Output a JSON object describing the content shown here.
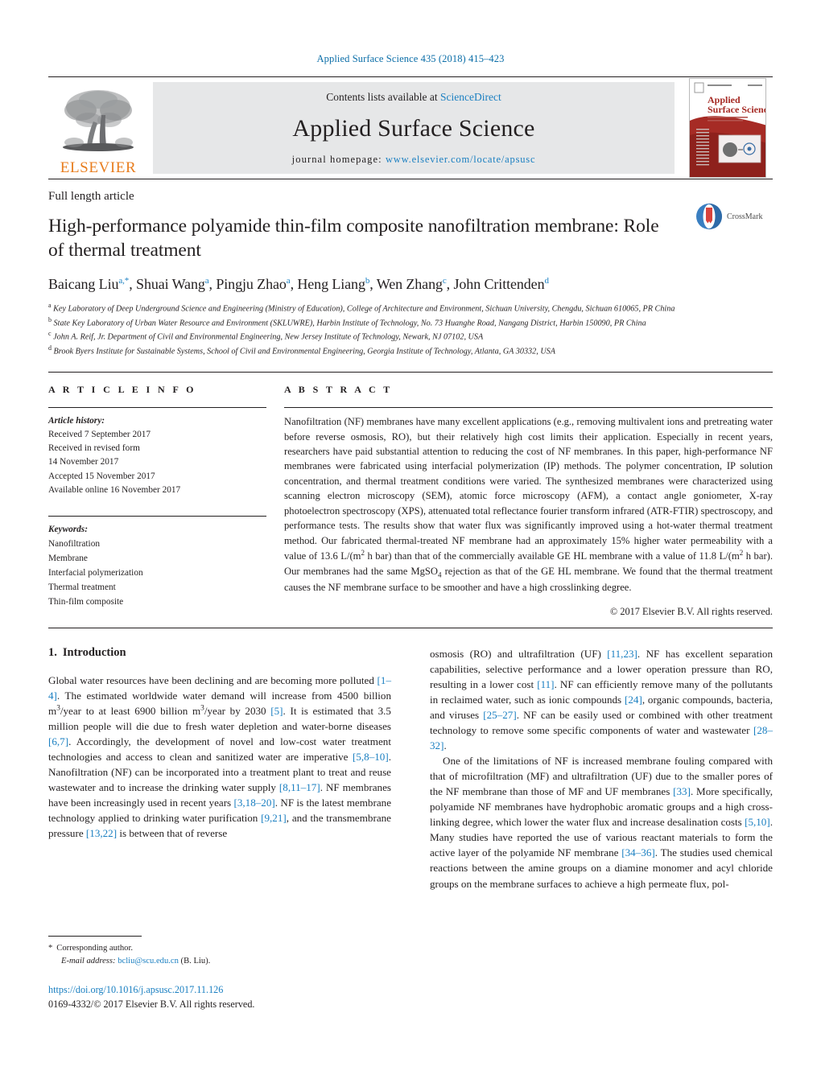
{
  "running_head": "Applied Surface Science 435 (2018) 415–423",
  "masthead": {
    "publisher_wordmark": "ELSEVIER",
    "contents_prefix": "Contents lists available at ",
    "contents_link": "ScienceDirect",
    "journal_name": "Applied Surface Science",
    "homepage_prefix": "journal homepage: ",
    "homepage_url": "www.elsevier.com/locate/apsusc",
    "cover": {
      "title_line1": "Applied",
      "title_line2": "Surface Science"
    }
  },
  "article": {
    "kicker": "Full length article",
    "title": "High-performance polyamide thin-film composite nanofiltration membrane: Role of thermal treatment",
    "crossmark_label": "CrossMark",
    "authors": [
      {
        "name": "Baicang Liu",
        "marks": "a,*"
      },
      {
        "name": "Shuai Wang",
        "marks": "a"
      },
      {
        "name": "Pingju Zhao",
        "marks": "a"
      },
      {
        "name": "Heng Liang",
        "marks": "b"
      },
      {
        "name": "Wen Zhang",
        "marks": "c"
      },
      {
        "name": "John Crittenden",
        "marks": "d"
      }
    ],
    "affiliations": [
      {
        "mark": "a",
        "text": "Key Laboratory of Deep Underground Science and Engineering (Ministry of Education), College of Architecture and Environment, Sichuan University, Chengdu, Sichuan 610065, PR China"
      },
      {
        "mark": "b",
        "text": "State Key Laboratory of Urban Water Resource and Environment (SKLUWRE), Harbin Institute of Technology, No. 73 Huanghe Road, Nangang District, Harbin 150090, PR China"
      },
      {
        "mark": "c",
        "text": "John A. Reif, Jr. Department of Civil and Environmental Engineering, New Jersey Institute of Technology, Newark, NJ 07102, USA"
      },
      {
        "mark": "d",
        "text": "Brook Byers Institute for Sustainable Systems, School of Civil and Environmental Engineering, Georgia Institute of Technology, Atlanta, GA 30332, USA"
      }
    ]
  },
  "article_info": {
    "heading": "A R T I C L E   I N F O",
    "history_label": "Article history:",
    "history": [
      "Received 7 September 2017",
      "Received in revised form",
      "14 November 2017",
      "Accepted 15 November 2017",
      "Available online 16 November 2017"
    ],
    "keywords_label": "Keywords:",
    "keywords": [
      "Nanofiltration",
      "Membrane",
      "Interfacial polymerization",
      "Thermal treatment",
      "Thin-film composite"
    ]
  },
  "abstract": {
    "heading": "A B S T R A C T",
    "copyright": "© 2017 Elsevier B.V. All rights reserved.",
    "parts": [
      {
        "t": "Nanofiltration (NF) membranes have many excellent applications (e.g., removing multivalent ions and pretreating water before reverse osmosis, RO), but their relatively high cost limits their application. Especially in recent years, researchers have paid substantial attention to reducing the cost of NF membranes. In this paper, high-performance NF membranes were fabricated using interfacial polymerization (IP) methods. The polymer concentration, IP solution concentration, and thermal treatment conditions were varied. The synthesized membranes were characterized using scanning electron microscopy (SEM), atomic force microscopy (AFM), a contact angle goniometer, X-ray photoelectron spectroscopy (XPS), attenuated total reflectance fourier transform infrared (ATR-FTIR) spectroscopy, and performance tests. The results show that water flux was significantly improved using a hot-water thermal treatment method. Our fabricated thermal-treated NF membrane had an approximately 15% higher water permeability with a value of 13.6 L/(m"
      },
      {
        "sup": "2"
      },
      {
        "t": " h bar) than that of the commercially available GE HL membrane with a value of 11.8 L/(m"
      },
      {
        "sup": "2"
      },
      {
        "t": " h bar). Our membranes had the same MgSO"
      },
      {
        "sub": "4"
      },
      {
        "t": " rejection as that of the GE HL membrane. We found that the thermal treatment causes the NF membrane surface to be smoother and have a high crosslinking degree."
      }
    ]
  },
  "intro": {
    "number": "1.",
    "title": "Introduction",
    "left_paragraph": [
      {
        "t": "Global water resources have been declining and are becoming more polluted "
      },
      {
        "cite": "[1–4]"
      },
      {
        "t": ". The estimated worldwide water demand will increase from 4500 billion m"
      },
      {
        "sup": "3"
      },
      {
        "t": "/year to at least 6900 billion m"
      },
      {
        "sup": "3"
      },
      {
        "t": "/year by 2030 "
      },
      {
        "cite": "[5]"
      },
      {
        "t": ". It is estimated that 3.5 million people will die due to fresh water depletion and water-borne diseases "
      },
      {
        "cite": "[6,7]"
      },
      {
        "t": ". Accordingly, the development of novel and low-cost water treatment technologies and access to clean and sanitized water are imperative "
      },
      {
        "cite": "[5,8–10]"
      },
      {
        "t": ". Nanofiltration (NF) can be incorporated into a treatment plant to treat and reuse wastewater and to increase the drinking water supply "
      },
      {
        "cite": "[8,11–17]"
      },
      {
        "t": ". NF membranes have been increasingly used in recent years "
      },
      {
        "cite": "[3,18–20]"
      },
      {
        "t": ". NF is the latest membrane technology applied to drinking water purification "
      },
      {
        "cite": "[9,21]"
      },
      {
        "t": ", and the transmembrane pressure "
      },
      {
        "cite": "[13,22]"
      },
      {
        "t": " is between that of reverse"
      }
    ],
    "right_paragraph_1": [
      {
        "t": "osmosis (RO) and ultrafiltration (UF) "
      },
      {
        "cite": "[11,23]"
      },
      {
        "t": ". NF has excellent separation capabilities, selective performance and a lower operation pressure than RO, resulting in a lower cost "
      },
      {
        "cite": "[11]"
      },
      {
        "t": ". NF can efficiently remove many of the pollutants in reclaimed water, such as ionic compounds "
      },
      {
        "cite": "[24]"
      },
      {
        "t": ", organic compounds, bacteria, and viruses "
      },
      {
        "cite": "[25–27]"
      },
      {
        "t": ". NF can be easily used or combined with other treatment technology to remove some specific components of water and wastewater "
      },
      {
        "cite": "[28–32]"
      },
      {
        "t": "."
      }
    ],
    "right_paragraph_2": [
      {
        "t": "One of the limitations of NF is increased membrane fouling compared with that of microfiltration (MF) and ultrafiltration (UF) due to the smaller pores of the NF membrane than those of MF and UF membranes "
      },
      {
        "cite": "[33]"
      },
      {
        "t": ". More specifically, polyamide NF membranes have hydrophobic aromatic groups and a high cross-linking degree, which lower the water flux and increase desalination costs "
      },
      {
        "cite": "[5,10]"
      },
      {
        "t": ". Many studies have reported the use of various reactant materials to form the active layer of the polyamide NF membrane "
      },
      {
        "cite": "[34–36]"
      },
      {
        "t": ". The studies used chemical reactions between the amine groups on a diamine monomer and acyl chloride groups on the membrane surfaces to achieve a high permeate flux, pol-"
      }
    ]
  },
  "footer": {
    "corresponding_label": "Corresponding author.",
    "email_label": "E-mail address:",
    "email": "bcliu@scu.edu.cn",
    "email_suffix": "(B. Liu).",
    "doi": "https://doi.org/10.1016/j.apsusc.2017.11.126",
    "issn": "0169-4332/© 2017 Elsevier B.V. All rights reserved."
  },
  "colors": {
    "link": "#1a7fc1",
    "elsevier_orange": "#e87d1e",
    "running_head": "#0b6ea8",
    "cover_red": "#a62b25"
  }
}
